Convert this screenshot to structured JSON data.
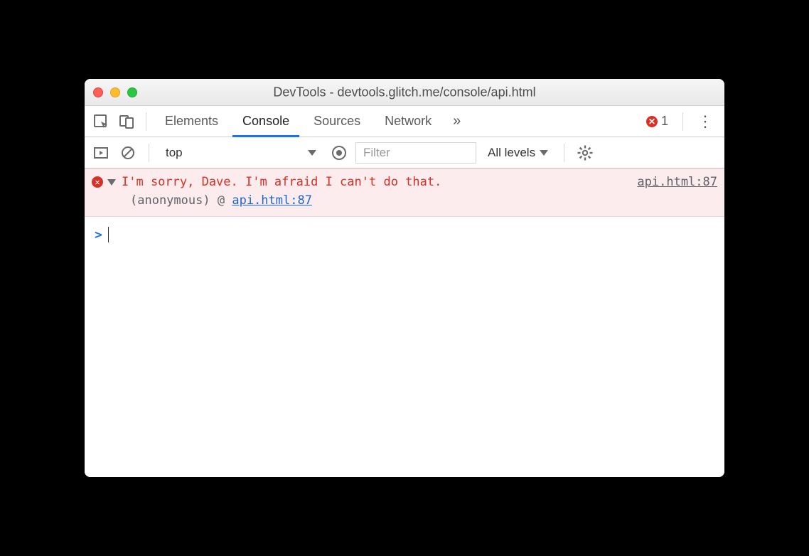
{
  "window": {
    "title": "DevTools - devtools.glitch.me/console/api.html"
  },
  "tabs": {
    "elements": "Elements",
    "console": "Console",
    "sources": "Sources",
    "network": "Network"
  },
  "error_badge": {
    "count": "1"
  },
  "toolbar": {
    "context": "top",
    "filter_placeholder": "Filter",
    "levels": "All levels"
  },
  "console": {
    "error": {
      "message": "I'm sorry, Dave. I'm afraid I can't do that.",
      "source_link": "api.html:87",
      "trace_label": "(anonymous)",
      "trace_at": "@",
      "trace_link": "api.html:87"
    },
    "prompt": ">"
  }
}
